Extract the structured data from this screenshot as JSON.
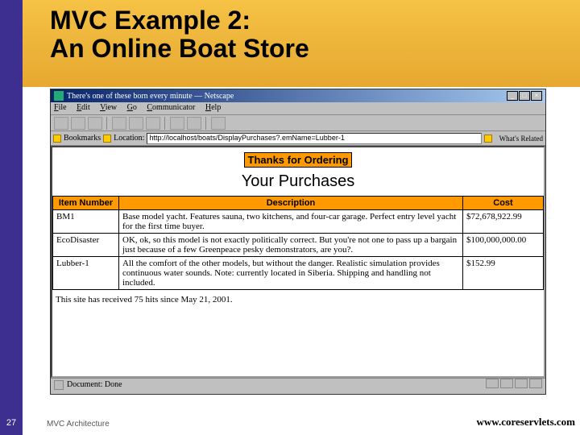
{
  "slide": {
    "title_line1": "MVC Example 2:",
    "title_line2": "An Online Boat Store",
    "page_number": "27",
    "footer_left": "MVC Architecture",
    "footer_right": "www.coreservlets.com"
  },
  "browser": {
    "window_title": "There's one of these born every minute — Netscape",
    "menus": {
      "file": "File",
      "edit": "Edit",
      "view": "View",
      "go": "Go",
      "comm": "Communicator",
      "help": "Help"
    },
    "bookmarks_label": "Bookmarks",
    "location_label": "Location:",
    "url": "http://localhost/boats/DisplayPurchases?.emName=Lubber-1",
    "whats_related": "What's Related",
    "status": "Document: Done"
  },
  "page": {
    "thanks": "Thanks for Ordering",
    "subtitle": "Your Purchases",
    "columns": {
      "item": "Item Number",
      "desc": "Description",
      "cost": "Cost"
    },
    "rows": [
      {
        "item": "BM1",
        "desc": "Base model yacht. Features sauna, two kitchens, and four-car garage. Perfect entry level yacht for the first time buyer.",
        "cost": "$72,678,922.99"
      },
      {
        "item": "EcoDisaster",
        "desc": "OK, ok, so this model is not exactly politically correct. But you're not one to pass up a bargain just because of a few Greenpeace pesky demonstrators, are you?.",
        "cost": "$100,000,000.00"
      },
      {
        "item": "Lubber-1",
        "desc": "All the comfort of the other models, but without the danger. Realistic simulation provides continuous water sounds. Note: currently located in Siberia. Shipping and handling not included.",
        "cost": "$152.99"
      }
    ],
    "hits": "This site has received 75 hits since May 21, 2001."
  }
}
